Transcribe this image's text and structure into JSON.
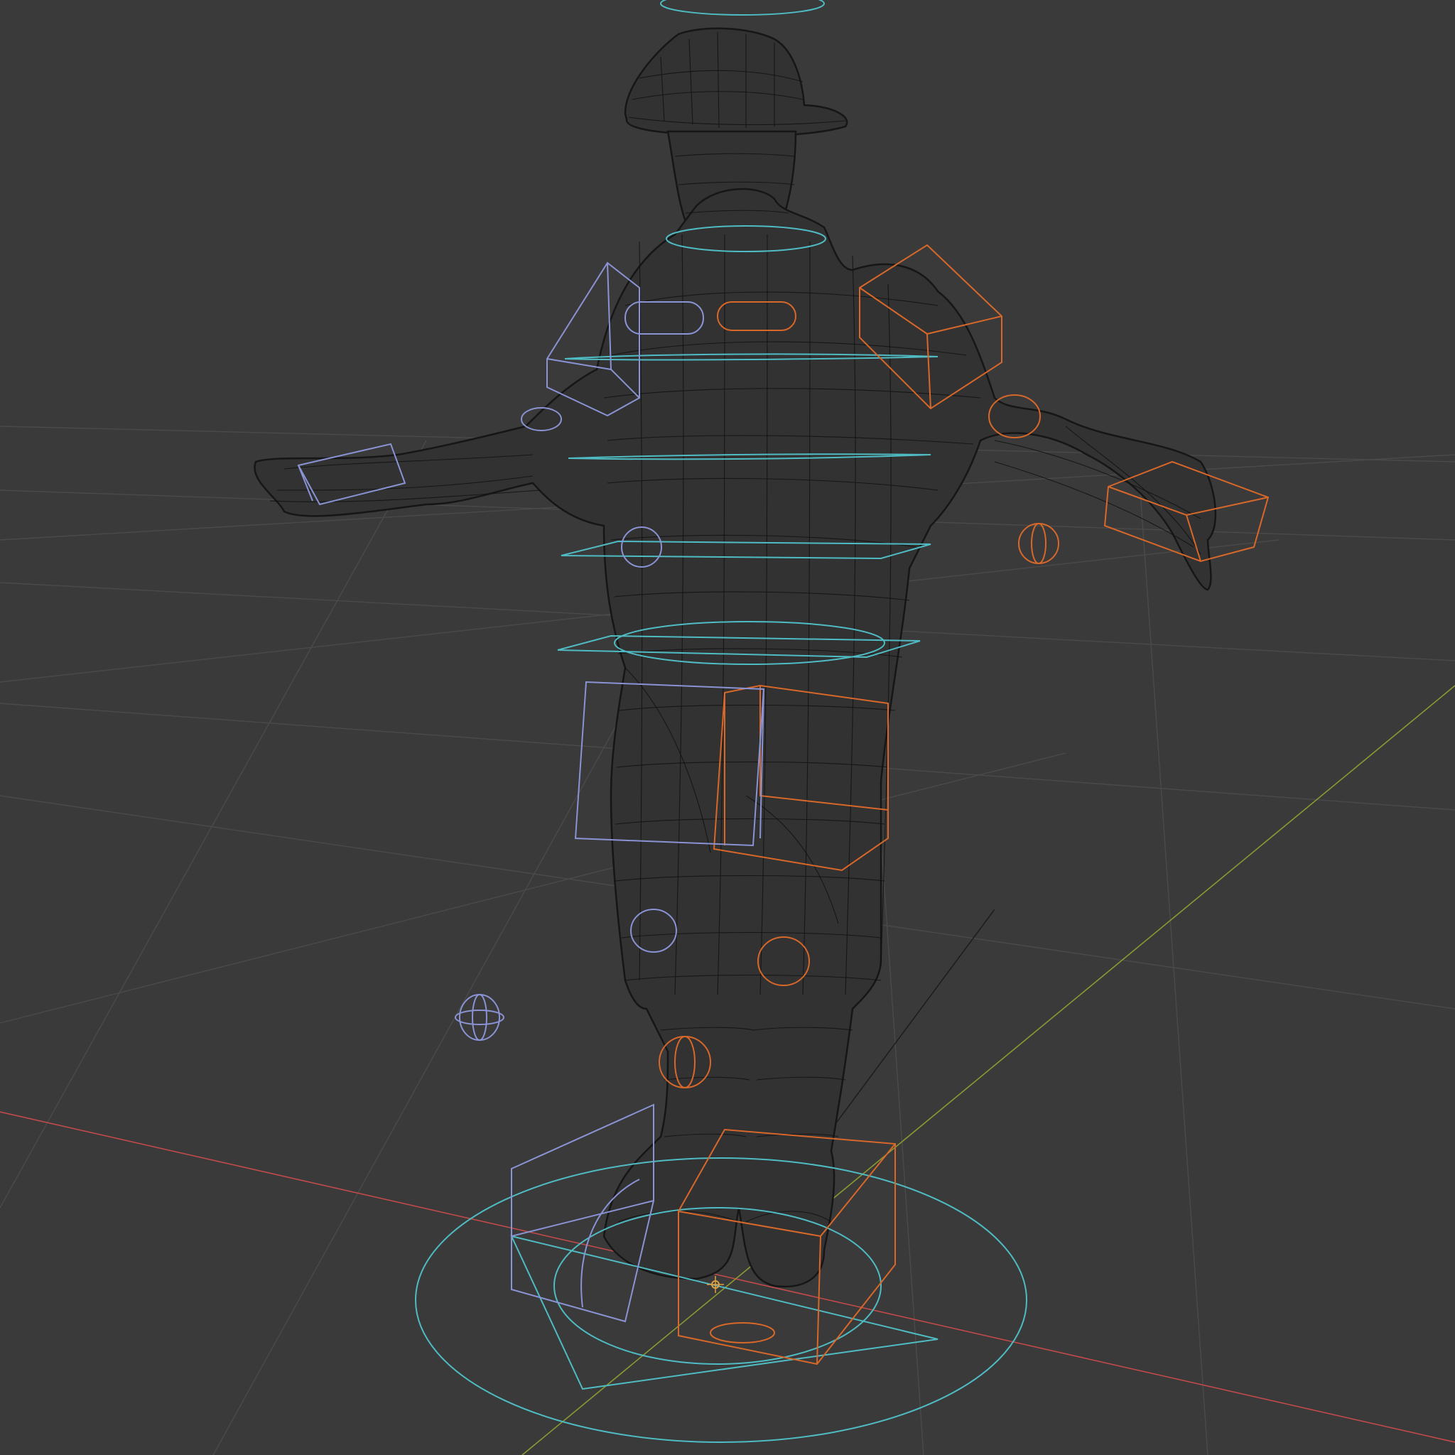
{
  "viewport": {
    "mode": "wireframe",
    "background": "#3a3a3a",
    "grid_color": "#4a4a4a",
    "axis_x_color": "#c24a4a",
    "axis_y_color": "#8a9a32",
    "mesh_color": "#121212",
    "controls": {
      "cyan": "#4fbcc4",
      "orange": "#d8682a",
      "blue": "#8a93d4"
    }
  }
}
